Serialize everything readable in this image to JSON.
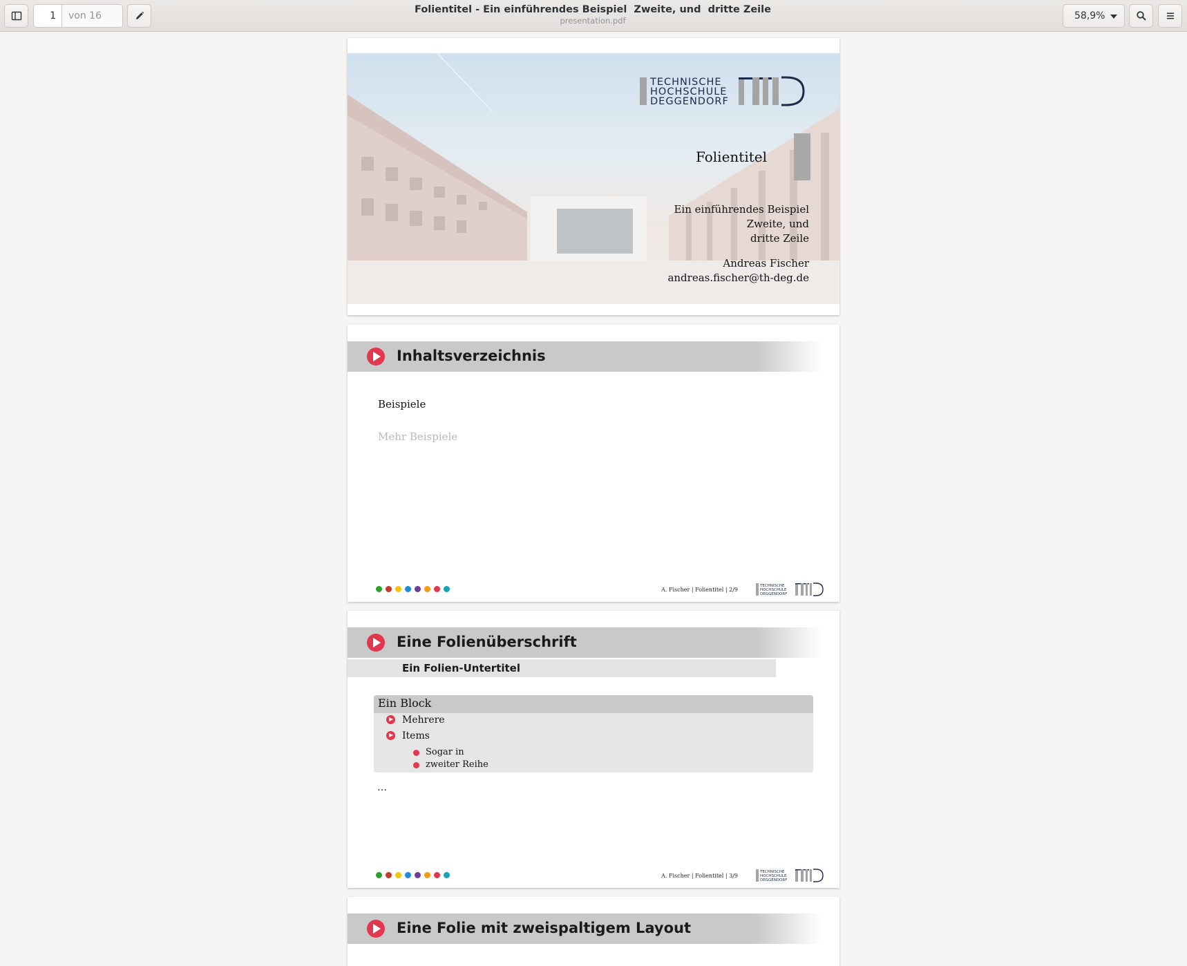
{
  "header": {
    "current_page": "1",
    "page_total": "von 16",
    "title": "Folientitel - Ein einführendes Beispiel  Zweite, und  dritte Zeile",
    "subtitle": "presentation.pdf",
    "zoom": "58,9%",
    "icons": [
      "sidebar-icon",
      "pencil-icon",
      "search-icon",
      "menu-icon"
    ]
  },
  "logo": {
    "line1": "TECHNISCHE",
    "line2": "HOCHSCHULE",
    "line3": "DEGGENDORF",
    "mark": "THD"
  },
  "slides": [
    {
      "title": "Folientitel",
      "subtitle_lines": [
        "Ein einführendes Beispiel",
        "Zweite, und",
        "dritte Zeile"
      ],
      "author": "Andreas Fischer",
      "email": "andreas.fischer@th-deg.de"
    },
    {
      "title": "Inhaltsverzeichnis",
      "toc": [
        "Beispiele",
        "Mehr Beispiele"
      ],
      "footer": "A. Fischer | Folientitel | 2/9"
    },
    {
      "title": "Eine Folienüberschrift",
      "subtitle": "Ein Folien-Untertitel",
      "block_title": "Ein Block",
      "items": [
        "Mehrere",
        "Items"
      ],
      "subitems": [
        "Sogar in",
        "zweiter Reihe"
      ],
      "after": "…",
      "footer": "A. Fischer | Folientitel | 3/9"
    },
    {
      "title": "Eine Folie mit zweispaltigem Layout"
    }
  ],
  "footer_dot_colors": [
    "#2ca02c",
    "#c0392b",
    "#f1c40f",
    "#1f8dd6",
    "#6a3d9a",
    "#f39c12",
    "#e2384f",
    "#17a2b8"
  ]
}
